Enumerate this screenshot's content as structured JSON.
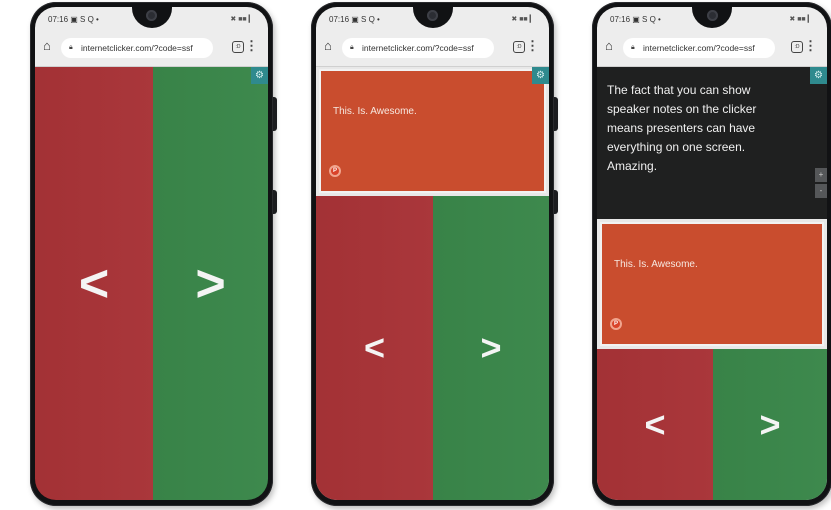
{
  "status_bar": {
    "time": "07:16",
    "notify_icons": "▣ S Q •",
    "system_icons": "✖ ■■ ▎"
  },
  "browser": {
    "url": "internetclicker.com/?code=ssf",
    "tabs_count": ":D"
  },
  "clicker": {
    "prev_label": "<",
    "next_label": ">",
    "settings_icon": "gear-icon"
  },
  "slide": {
    "text": "This. Is. Awesome.",
    "app_icon_label": "P"
  },
  "speaker_notes": {
    "text": "The fact that you can show speaker notes on the clicker means presenters can have everything on one screen. Amazing."
  },
  "zoom": {
    "plus": "+",
    "minus": "-"
  },
  "colors": {
    "prev": "#a83337",
    "next": "#3a874a",
    "slide": "#c94d2e",
    "settings": "#2f8a8e",
    "notes_bg": "#1f2020"
  }
}
